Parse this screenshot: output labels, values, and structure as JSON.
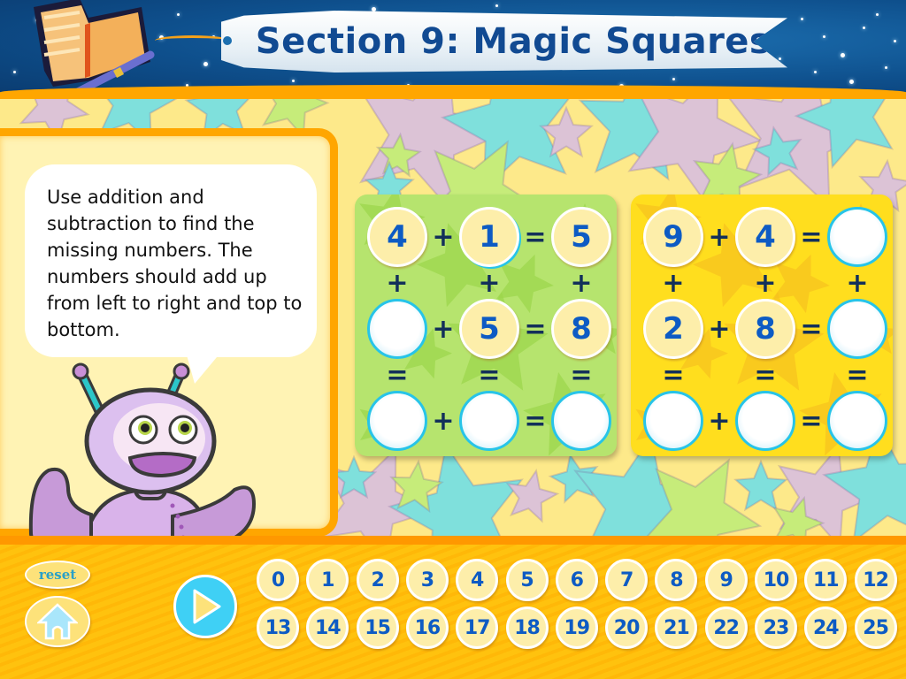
{
  "header": {
    "title": "Section 9: Magic Squares",
    "logo_icon": "book-and-pen-icon"
  },
  "instructions": {
    "text": "Use addition and subtraction to find the missing numbers. The numbers should add up from left to right and top to bottom.",
    "character": "purple-robot-mascot"
  },
  "puzzles": [
    {
      "name": "green-puzzle",
      "color": "#b6e46e",
      "cells": [
        [
          "4",
          "1",
          "5"
        ],
        [
          "",
          "5",
          "8"
        ],
        [
          "",
          "",
          ""
        ]
      ],
      "selected_cell": [
        0,
        1
      ]
    },
    {
      "name": "yellow-puzzle",
      "color": "#ffde1e",
      "cells": [
        [
          "9",
          "4",
          ""
        ],
        [
          "2",
          "8",
          ""
        ],
        [
          "",
          "",
          ""
        ]
      ]
    }
  ],
  "operators": {
    "plus": "+",
    "equals": "="
  },
  "controls": {
    "reset_label": "reset",
    "home_icon": "home-icon",
    "play_icon": "play-icon"
  },
  "number_tiles": [
    "0",
    "1",
    "2",
    "3",
    "4",
    "5",
    "6",
    "7",
    "8",
    "9",
    "10",
    "11",
    "12",
    "13",
    "14",
    "15",
    "16",
    "17",
    "18",
    "19",
    "20",
    "21",
    "22",
    "23",
    "24",
    "25"
  ],
  "colors": {
    "accent_orange": "#ffa600",
    "number_blue": "#0d5bc4",
    "empty_ring": "#27c4e8",
    "title_blue": "#114a92"
  }
}
